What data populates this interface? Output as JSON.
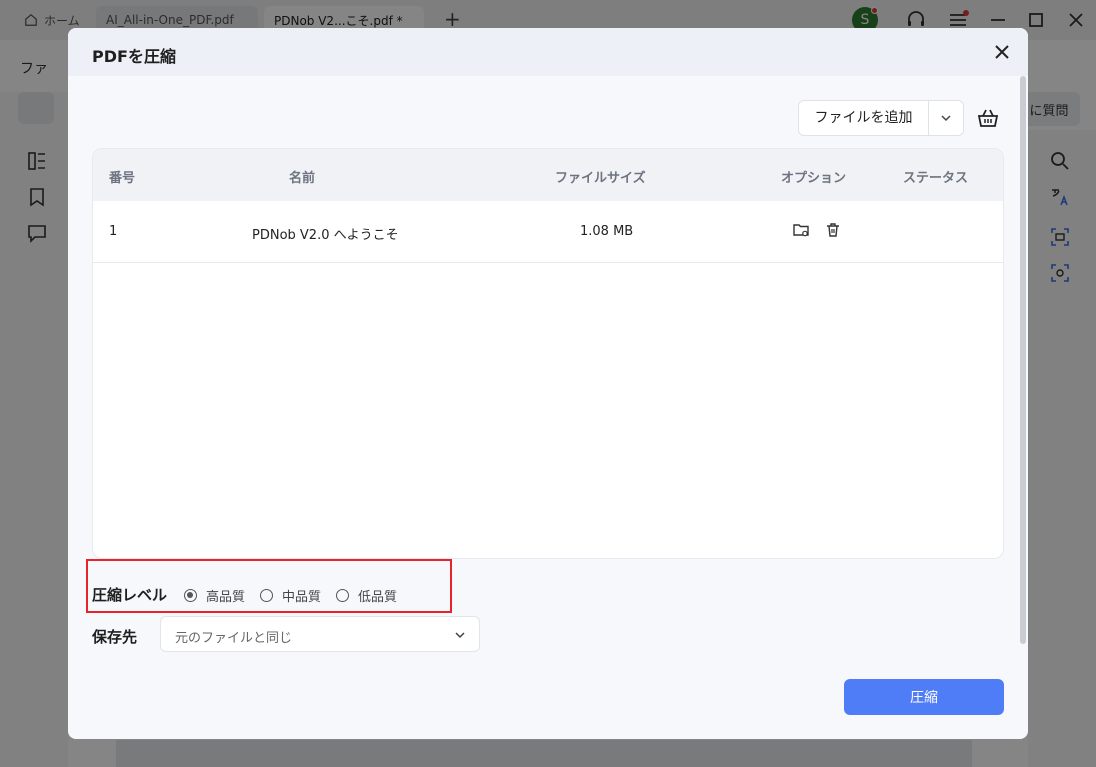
{
  "app": {
    "tabs": [
      {
        "label": "ホーム"
      },
      {
        "label": "AI_All-in-One_PDF.pdf"
      },
      {
        "label": "PDNob V2...こそ.pdf *"
      }
    ],
    "avatar_initial": "S",
    "toolbar_left_label": "ファ",
    "ask_button_label": "に質問"
  },
  "dialog": {
    "title": "PDFを圧縮",
    "add_file_label": "ファイルを追加",
    "table": {
      "headers": {
        "number": "番号",
        "name": "名前",
        "size": "ファイルサイズ",
        "options": "オプション",
        "status": "ステータス"
      },
      "rows": [
        {
          "number": "1",
          "name": "PDNob V2.0 へようこそ",
          "size": "1.08 MB",
          "status": ""
        }
      ]
    },
    "compression": {
      "label": "圧縮レベル",
      "options": [
        "高品質",
        "中品質",
        "低品質"
      ],
      "selected": "高品質"
    },
    "destination": {
      "label": "保存先",
      "value": "元のファイルと同じ"
    },
    "compress_button": "圧縮"
  },
  "colors": {
    "primary": "#4f7cf7",
    "highlight": "#e8242a",
    "avatar": "#2e7d32"
  }
}
